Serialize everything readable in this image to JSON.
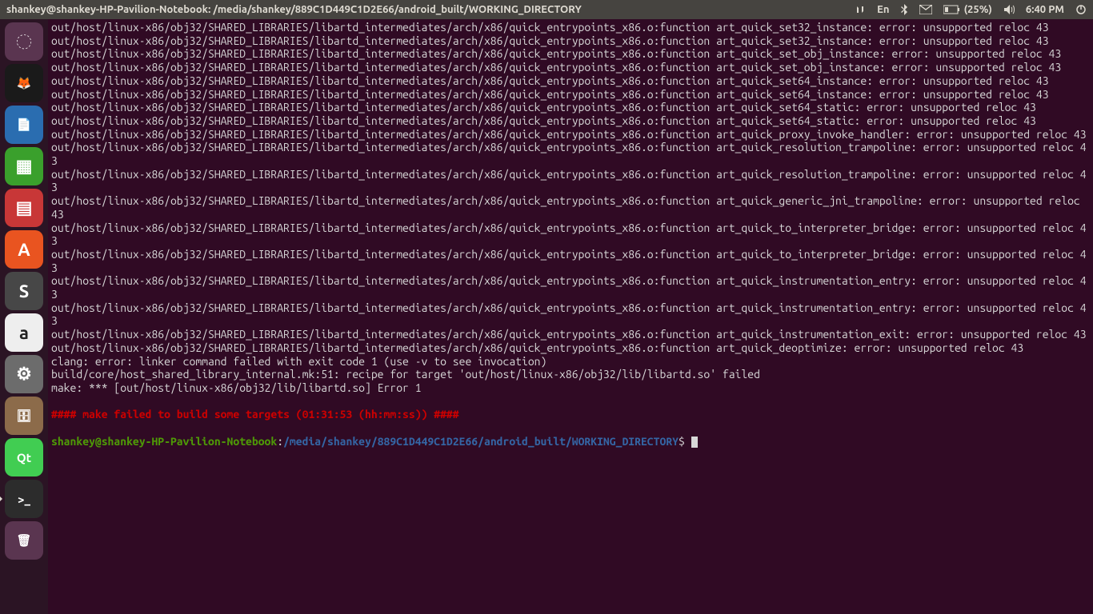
{
  "menubar": {
    "title": "shankey@shankey-HP-Pavilion-Notebook: /media/shankey/889C1D449C1D2E66/android_built/WORKING_DIRECTORY",
    "lang": "En",
    "battery": "(25%)",
    "time": "6:40 PM"
  },
  "launcher": {
    "items": [
      {
        "name": "dash-icon",
        "bg": "#5a3550",
        "glyph": "◌"
      },
      {
        "name": "firefox-icon",
        "bg": "#1a1a1a",
        "glyph": "🦊"
      },
      {
        "name": "writer-icon",
        "bg": "#2a6db0",
        "glyph": "📄"
      },
      {
        "name": "calc-icon",
        "bg": "#3aa02c",
        "glyph": "▦"
      },
      {
        "name": "impress-icon",
        "bg": "#c83737",
        "glyph": "▤"
      },
      {
        "name": "software-icon",
        "bg": "#e95420",
        "glyph": "A"
      },
      {
        "name": "sublime-icon",
        "bg": "#474747",
        "glyph": "S"
      },
      {
        "name": "amazon-icon",
        "bg": "#eeeeee",
        "glyph": "a",
        "color": "#222"
      },
      {
        "name": "settings-icon",
        "bg": "#6c6c6c",
        "glyph": "⚙"
      },
      {
        "name": "files-icon",
        "bg": "#8c6b4a",
        "glyph": "🗄"
      },
      {
        "name": "qt-icon",
        "bg": "#41cd52",
        "glyph": "Qt"
      },
      {
        "name": "terminal-icon",
        "bg": "#2c2c2c",
        "glyph": ">_",
        "active": true
      },
      {
        "name": "trash-icon",
        "bg": "#5a3550",
        "glyph": "🗑"
      }
    ]
  },
  "terminal": {
    "path_prefix": "out/host/linux-x86/obj32/SHARED_LIBRARIES/libartd_intermediates/arch/x86/quick_entrypoints_x86.o:function ",
    "reloc_msg": "unsupported reloc 43",
    "errors": [
      "art_quick_set32_instance: error: ",
      "art_quick_set32_instance: error: ",
      "art_quick_set_obj_instance: error: ",
      "art_quick_set_obj_instance: error: ",
      "art_quick_set64_instance: error: ",
      "art_quick_set64_instance: error: ",
      "art_quick_set64_static: error: ",
      "art_quick_set64_static: error: ",
      "art_quick_proxy_invoke_handler: error: ",
      "art_quick_resolution_trampoline: error: ",
      "art_quick_resolution_trampoline: error: ",
      "art_quick_generic_jni_trampoline: error: ",
      "art_quick_to_interpreter_bridge: error: ",
      "art_quick_to_interpreter_bridge: error: ",
      "art_quick_instrumentation_entry: error: ",
      "art_quick_instrumentation_entry: error: ",
      "art_quick_instrumentation_exit: error: ",
      "art_quick_deoptimize: error: "
    ],
    "clang": "clang: error: linker command failed with exit code 1 (use -v to see invocation)",
    "build": "build/core/host_shared_library_internal.mk:51: recipe for target 'out/host/linux-x86/obj32/lib/libartd.so' failed",
    "make": "make: *** [out/host/linux-x86/obj32/lib/libartd.so] Error 1",
    "fail": "#### make failed to build some targets (01:31:53 (hh:mm:ss)) ####",
    "prompt_user": "shankey@shankey-HP-Pavilion-Notebook",
    "prompt_sep": ":",
    "prompt_path": "/media/shankey/889C1D449C1D2E66/android_built/WORKING_DIRECTORY",
    "prompt_end": "$ "
  }
}
